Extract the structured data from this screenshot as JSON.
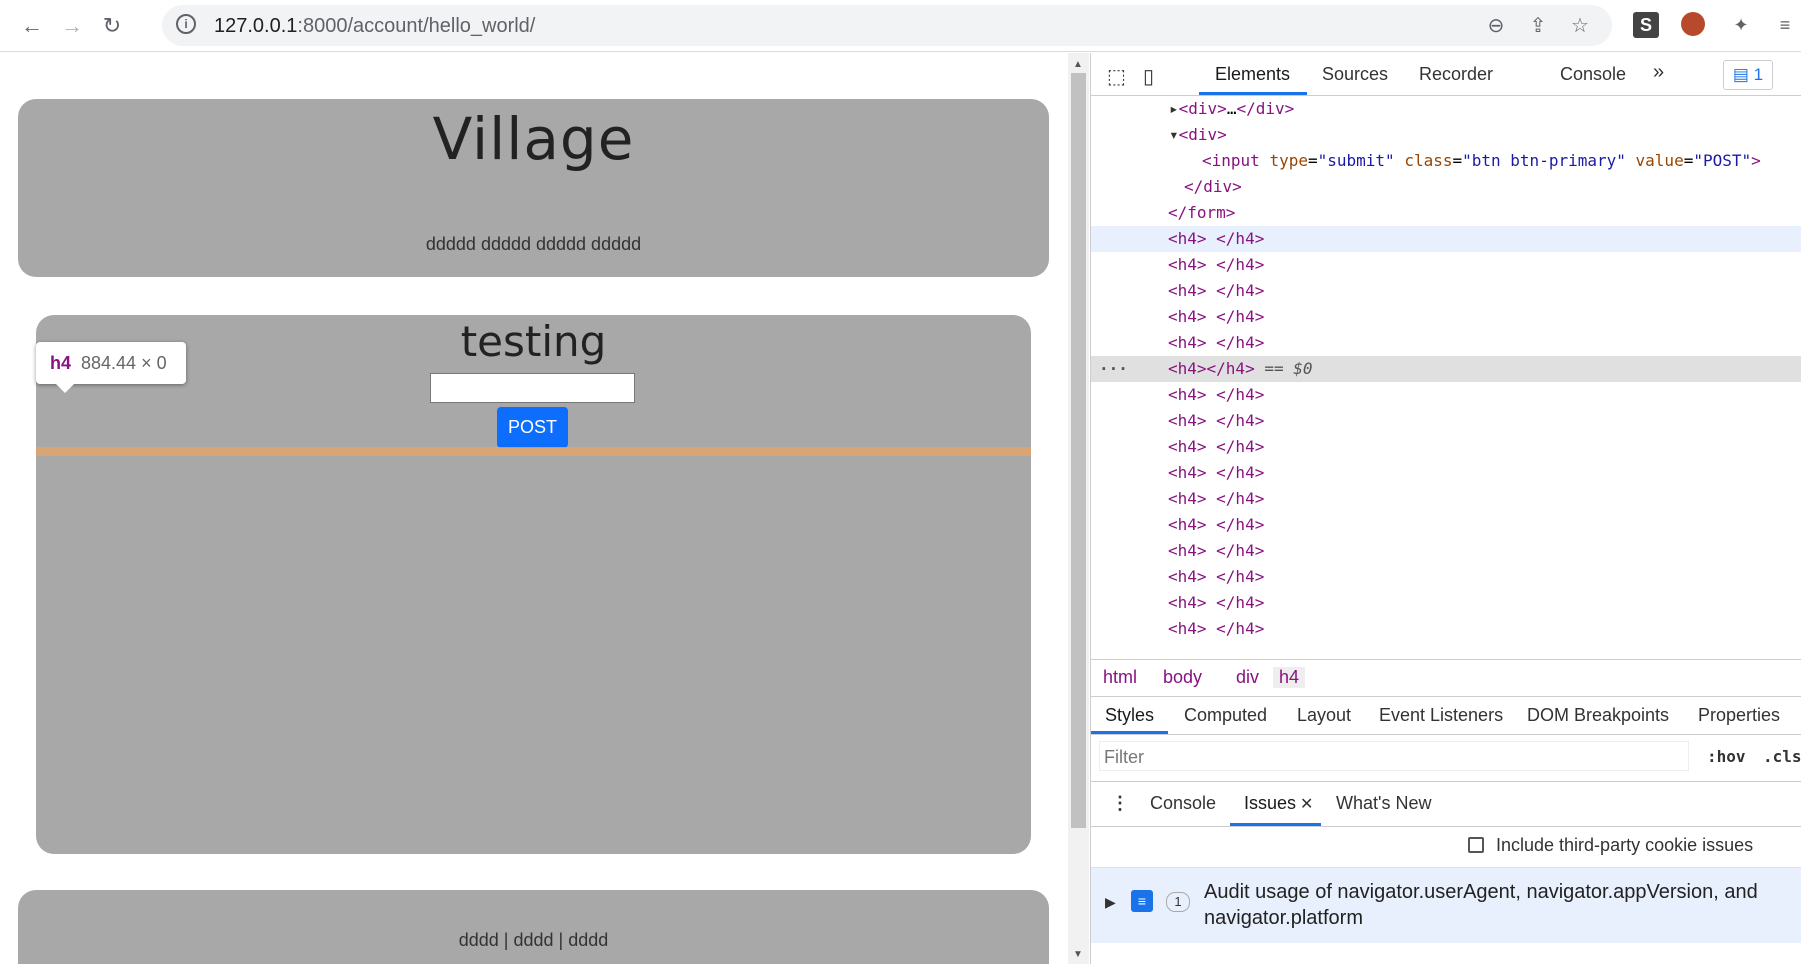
{
  "browser": {
    "url_host": "127.0.0.1",
    "url_rest": ":8000/account/hello_world/",
    "back_icon": "←",
    "forward_icon": "→",
    "reload_icon": "↻",
    "info_icon": "i",
    "zoom_icon": "⊖",
    "share_icon": "⇪",
    "star_icon": "☆",
    "ext_s_label": "S",
    "puzzle_icon": "✦",
    "menu_icon": "≡"
  },
  "page": {
    "village_title": "Village",
    "village_subtitle": "ddddd ddddd ddddd ddddd",
    "testing_title": "testing",
    "post_button": "POST",
    "footer_links": "dddd | dddd | dddd",
    "tooltip_tag": "h4",
    "tooltip_dims": "884.44 × 0"
  },
  "devtools": {
    "tabs": [
      "Elements",
      "Sources",
      "Recorder",
      "Console"
    ],
    "more_icon": "»",
    "issues_count": "1",
    "code": {
      "line0_a": "<div>",
      "line0_b": "…",
      "line0_c": "</div>",
      "line1": "<div>",
      "line2_tag_open": "<input",
      "line2_attr1": "type",
      "line2_val1": "\"submit\"",
      "line2_attr2": "class",
      "line2_val2": "\"btn btn-primary\"",
      "line2_attr3": "value",
      "line2_val3": "\"POST\"",
      "line2_close": ">",
      "line3": "</div>",
      "line4": "</form>",
      "h4_line": "<h4> </h4>",
      "h4_selected": "<h4></h4>",
      "selected_suffix": " == $0"
    },
    "breadcrumbs": [
      "html",
      "body",
      "div",
      "h4"
    ],
    "styles_tabs": [
      "Styles",
      "Computed",
      "Layout",
      "Event Listeners",
      "DOM Breakpoints",
      "Properties"
    ],
    "filter_placeholder": "Filter",
    "hov_label": ":hov",
    "cls_label": ".cls",
    "drawer_tabs": [
      "Console",
      "Issues",
      "What's New"
    ],
    "close_icon": "✕",
    "cookie_label": "Include third-party cookie issues",
    "issue_text": "Audit usage of navigator.userAgent, navigator.appVersion, and navigator.platform",
    "issue_count": "1"
  }
}
